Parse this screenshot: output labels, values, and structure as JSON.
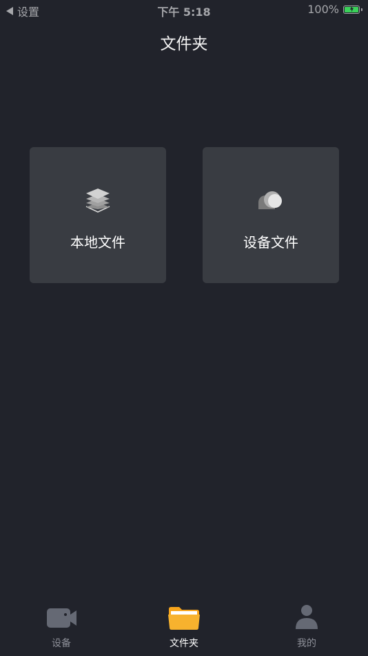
{
  "status_bar": {
    "back_label": "设置",
    "time": "下午 5:18",
    "battery_percent": "100%",
    "battery_level": 1.0,
    "battery_color": "#3bd15a"
  },
  "nav": {
    "title": "文件夹"
  },
  "cards": [
    {
      "label": "本地文件",
      "icon": "layers-icon"
    },
    {
      "label": "设备文件",
      "icon": "cloud-icon"
    }
  ],
  "tab_bar": {
    "active_index": 1,
    "active_color": "#f5a623",
    "tabs": [
      {
        "label": "设备",
        "icon": "video-camera-icon"
      },
      {
        "label": "文件夹",
        "icon": "folder-icon"
      },
      {
        "label": "我的",
        "icon": "person-icon"
      }
    ]
  }
}
